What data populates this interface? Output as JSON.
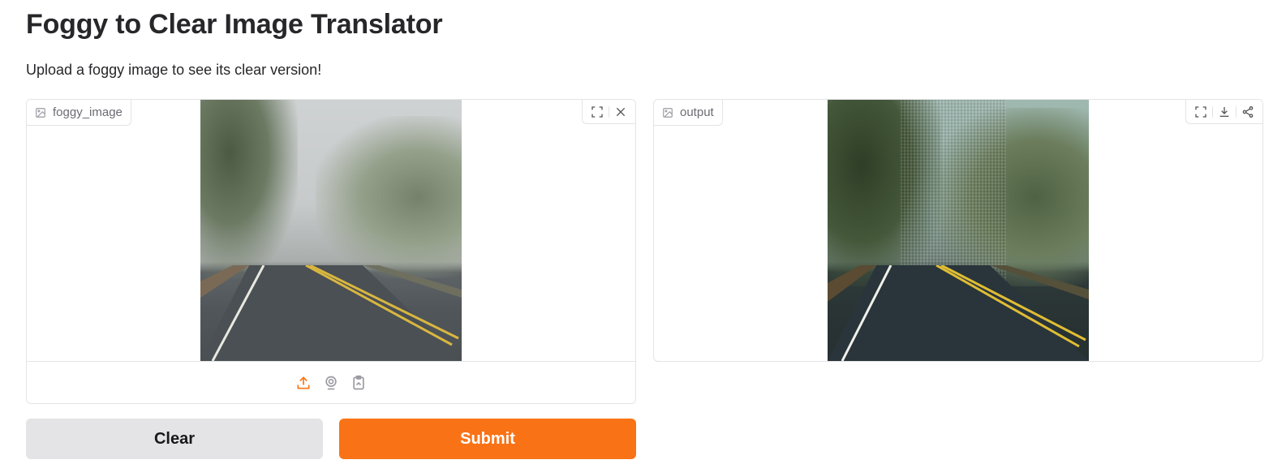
{
  "app": {
    "title": "Foggy to Clear Image Translator",
    "description": "Upload a foggy image to see its clear version!"
  },
  "input_panel": {
    "label": "foggy_image",
    "label_icon": "image-icon",
    "toolbar_icons": [
      "fullscreen-icon",
      "close-icon"
    ],
    "source_icons": [
      "upload-icon",
      "webcam-icon",
      "clipboard-icon"
    ]
  },
  "output_panel": {
    "label": "output",
    "label_icon": "image-icon",
    "toolbar_icons": [
      "fullscreen-icon",
      "download-icon",
      "share-icon"
    ]
  },
  "buttons": {
    "clear_label": "Clear",
    "submit_label": "Submit"
  },
  "colors": {
    "accent": "#f97316",
    "secondary": "#e4e4e7",
    "border": "#e4e4e7"
  }
}
